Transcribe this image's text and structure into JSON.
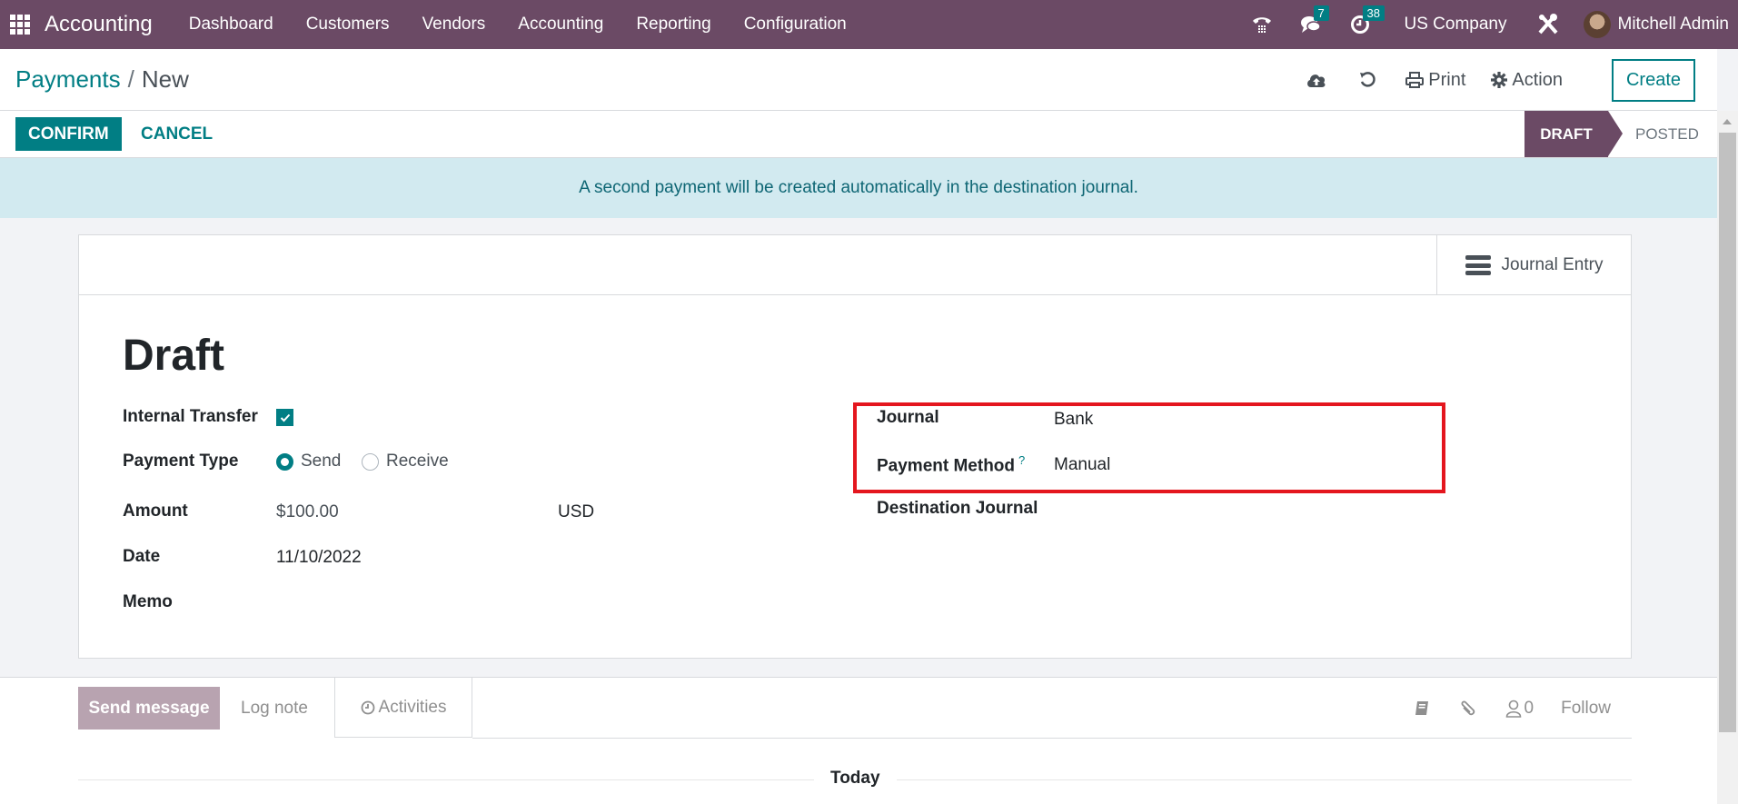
{
  "navbar": {
    "app_name": "Accounting",
    "menu": [
      "Dashboard",
      "Customers",
      "Vendors",
      "Accounting",
      "Reporting",
      "Configuration"
    ],
    "messages_count": "7",
    "activities_count": "38",
    "company": "US Company",
    "user": "Mitchell Admin",
    "icons": [
      "apps-grid-icon",
      "phone-icon",
      "chat-icon",
      "clock-icon",
      "tools-icon"
    ]
  },
  "control_panel": {
    "breadcrumb_parent": "Payments",
    "breadcrumb_separator": "/",
    "breadcrumb_current": "New",
    "print_label": "Print",
    "action_label": "Action",
    "create_label": "Create"
  },
  "statusbar": {
    "confirm_label": "CONFIRM",
    "cancel_label": "CANCEL",
    "stages": [
      "DRAFT",
      "POSTED"
    ],
    "active_stage": "DRAFT"
  },
  "alert": {
    "message": "A second payment will be created automatically in the destination journal."
  },
  "sheet": {
    "journal_entry_label": "Journal Entry",
    "title": "Draft",
    "fields": {
      "internal_transfer": {
        "label": "Internal Transfer",
        "checked": true
      },
      "payment_type": {
        "label": "Payment Type",
        "options": [
          "Send",
          "Receive"
        ],
        "selected": "Send"
      },
      "amount": {
        "label": "Amount",
        "value": "$100.00",
        "currency": "USD"
      },
      "date": {
        "label": "Date",
        "value": "11/10/2022"
      },
      "memo": {
        "label": "Memo",
        "value": ""
      },
      "journal": {
        "label": "Journal",
        "value": "Bank"
      },
      "payment_method": {
        "label": "Payment Method",
        "help": "?",
        "value": "Manual"
      },
      "destination_journal": {
        "label": "Destination Journal",
        "value": ""
      }
    },
    "highlight_color": "#e4161e"
  },
  "chatter": {
    "send_message_label": "Send message",
    "log_note_label": "Log note",
    "activities_label": "Activities",
    "followers_count": "0",
    "follow_label": "Follow",
    "today_label": "Today"
  },
  "colors": {
    "brand": "#6b4a65",
    "accent": "#017e84",
    "alert_bg": "#d2eaf0"
  }
}
